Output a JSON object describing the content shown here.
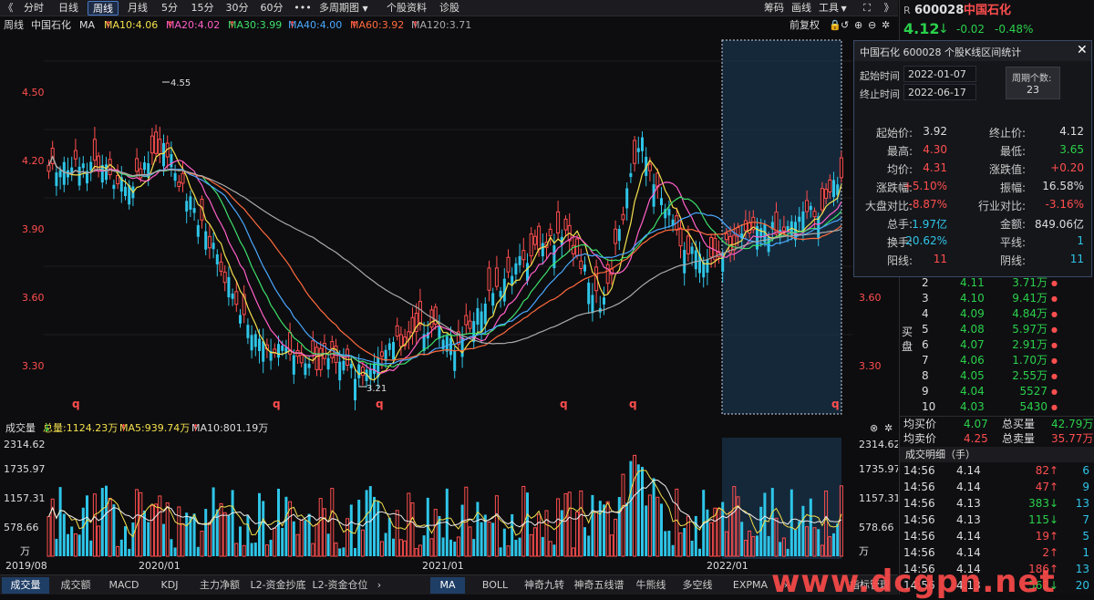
{
  "toolbar": {
    "back": "《",
    "periods": [
      "分时",
      "日线",
      "周线",
      "月线",
      "5分",
      "15分",
      "30分",
      "60分"
    ],
    "active_period": "周线",
    "more": "•••",
    "multi_period": "多周期图",
    "stock_info": "个股资料",
    "diagnose": "诊股",
    "right_items": [
      "筹码",
      "画线",
      "工具"
    ],
    "forward": "》"
  },
  "ma_row": {
    "period": "周线",
    "name": "中国石化",
    "ma_label": "MA",
    "ma10": "MA10:4.06",
    "ma20": "MA20:4.02",
    "ma30": "MA30:3.99",
    "ma40": "MA40:4.00",
    "ma60": "MA60:3.92",
    "ma120": "MA120:3.71",
    "adjust": "前复权",
    "colors": {
      "ma10": "#f4e04d",
      "ma20": "#ff5fc8",
      "ma30": "#3ee06a",
      "ma40": "#4aa8ff",
      "ma60": "#ff6a3d",
      "ma120": "#aaaaaa"
    }
  },
  "quote": {
    "flag": "R",
    "code": "600028",
    "name": "中国石化",
    "price": "4.12",
    "change": "-0.02",
    "change_pct": "-0.48%"
  },
  "stat_popup": {
    "title": "中国石化  600028  个股K线区间统计",
    "start_time_label": "起始时间",
    "start_time": "2022-01-07",
    "end_time_label": "终止时间",
    "end_time": "2022-06-17",
    "period_count_label": "周期个数:",
    "period_count": "23",
    "rows": [
      {
        "l1": "起始价:",
        "v1": "3.92",
        "c1": "wh",
        "l2": "终止价:",
        "v2": "4.12",
        "c2": "wh"
      },
      {
        "l1": "最高:",
        "v1": "4.30",
        "c1": "up",
        "l2": "最低:",
        "v2": "3.65",
        "c2": "dn"
      },
      {
        "l1": "均价:",
        "v1": "4.31",
        "c1": "up",
        "l2": "涨跌值:",
        "v2": "+0.20",
        "c2": "up"
      },
      {
        "l1": "涨跌幅:",
        "v1": "+5.10%",
        "c1": "up",
        "l2": "振幅:",
        "v2": "16.58%",
        "c2": "wh"
      },
      {
        "l1": "大盘对比:",
        "v1": "-8.87%",
        "c1": "up",
        "l2": "行业对比:",
        "v2": "-3.16%",
        "c2": "up"
      },
      {
        "l1": "总手:",
        "v1": "1.97亿",
        "c1": "blue",
        "l2": "金额:",
        "v2": "849.06亿",
        "c2": "wh"
      },
      {
        "l1": "换手:",
        "v1": "20.62%",
        "c1": "blue",
        "l2": "平线:",
        "v2": "1",
        "c2": "blue"
      },
      {
        "l1": "阳线:",
        "v1": "11",
        "c1": "up",
        "l2": "阴线:",
        "v2": "11",
        "c2": "blue"
      }
    ]
  },
  "orderbook": {
    "buy_label": "买盘",
    "rows": [
      {
        "lvl": "2",
        "price": "4.11",
        "vol": "3.71万"
      },
      {
        "lvl": "3",
        "price": "4.10",
        "vol": "9.41万"
      },
      {
        "lvl": "4",
        "price": "4.09",
        "vol": "4.84万"
      },
      {
        "lvl": "5",
        "price": "4.08",
        "vol": "5.97万"
      },
      {
        "lvl": "6",
        "price": "4.07",
        "vol": "2.91万"
      },
      {
        "lvl": "7",
        "price": "4.06",
        "vol": "1.70万"
      },
      {
        "lvl": "8",
        "price": "4.05",
        "vol": "2.55万"
      },
      {
        "lvl": "9",
        "price": "4.04",
        "vol": "5527"
      },
      {
        "lvl": "10",
        "price": "4.03",
        "vol": "5430"
      }
    ],
    "avg_buy_label": "均买价",
    "avg_buy": "4.07",
    "total_buy_label": "总买量",
    "total_buy": "42.79万",
    "avg_sell_label": "均卖价",
    "avg_sell": "4.25",
    "total_sell_label": "总卖量",
    "total_sell": "35.77万"
  },
  "trades": {
    "title": "成交明细（手）",
    "rows": [
      {
        "t": "14:56",
        "p": "4.14",
        "v": "82",
        "d": "up",
        "n": "6"
      },
      {
        "t": "14:56",
        "p": "4.14",
        "v": "47",
        "d": "up",
        "n": "9"
      },
      {
        "t": "14:56",
        "p": "4.13",
        "v": "383",
        "d": "dn",
        "n": "13"
      },
      {
        "t": "14:56",
        "p": "4.13",
        "v": "115",
        "d": "dn",
        "n": "7"
      },
      {
        "t": "14:56",
        "p": "4.14",
        "v": "19",
        "d": "up",
        "n": "5"
      },
      {
        "t": "14:56",
        "p": "4.14",
        "v": "2",
        "d": "up",
        "n": "1"
      },
      {
        "t": "14:56",
        "p": "4.14",
        "v": "186",
        "d": "up",
        "n": "13"
      },
      {
        "t": "14:56",
        "p": "4.13",
        "v": "562",
        "d": "dn",
        "n": "20"
      }
    ]
  },
  "price_axis": [
    "4.50",
    "4.20",
    "3.90",
    "3.60",
    "3.30"
  ],
  "annotations": {
    "high": "4.55",
    "low": "3.21",
    "marker": "q"
  },
  "volume": {
    "title": "成交量",
    "total": "总量:1124.23万",
    "ma5": "MA5:939.74万",
    "ma10": "MA10:801.19万",
    "axis": [
      "2314.62",
      "1735.97",
      "1157.31",
      "578.66"
    ],
    "unit": "万"
  },
  "dates": [
    "2019/08",
    "2020/01",
    "2021/01",
    "2022/01"
  ],
  "bottom_tabs": [
    "成交量",
    "成交额",
    "MACD",
    "KDJ",
    "主力净额",
    "L2-资金抄底",
    "L2-资金仓位",
    "MA",
    "BOLL",
    "神奇九转",
    "神奇五线谱",
    "牛熊线",
    "多空线",
    "EXPMA"
  ],
  "bottom_active": [
    "成交量",
    "MA"
  ],
  "bottom_right": "指标管理",
  "watermark": "www.dcgpn.net"
}
